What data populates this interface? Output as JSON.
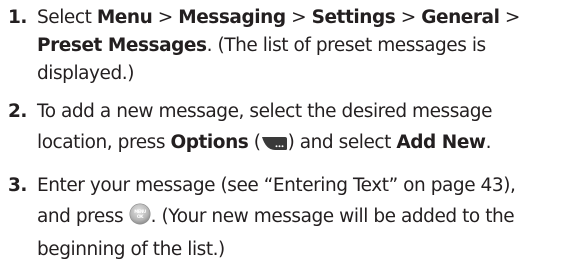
{
  "steps": [
    {
      "number": "1.",
      "line1_a": "Select ",
      "menu": "Menu",
      "sep1": " > ",
      "messaging": "Messaging",
      "sep2": " > ",
      "settings": "Settings",
      "sep3": " > ",
      "general": "General",
      "sep4": " >",
      "preset_messages": "Preset Messages",
      "line2_rest": ". (The list of preset messages is",
      "line3": "displayed.)"
    },
    {
      "number": "2.",
      "line1": "To add a new message, select the desired message",
      "line2_a": "location, press ",
      "options": "Options",
      "paren_open": " (",
      "options_icon": "options-softkey-icon",
      "paren_close": ") and select ",
      "add_new": "Add New",
      "end": "."
    },
    {
      "number": "3.",
      "line1": "Enter your message (see “Entering Text” on page 43),",
      "line2_a": "and press ",
      "ok_icon": "menu-ok-key-icon",
      "line2_b": ". (Your new message will be added to the",
      "line3": "beginning of the list.)"
    }
  ],
  "icons": {
    "ok_key_top_text": "MENU",
    "ok_key_bottom_text": "OK"
  },
  "colors": {
    "text": "#231f20",
    "step_number": "#231f20",
    "icon_dark": "#3a3a3a",
    "icon_light": "#c4c4c4"
  }
}
